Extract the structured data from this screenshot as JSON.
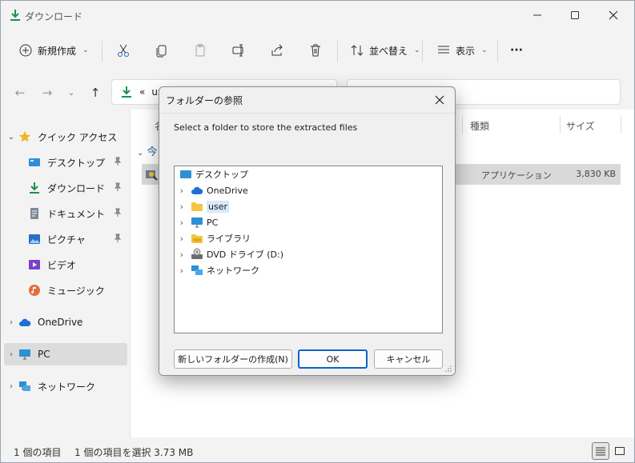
{
  "window": {
    "title": "ダウンロード"
  },
  "toolbar": {
    "new_label": "新規作成",
    "sort_label": "並べ替え",
    "view_label": "表示",
    "more_label": "···"
  },
  "address": {
    "prefix": "«",
    "path": "us"
  },
  "sidebar": {
    "quick_access": "クイック アクセス",
    "items": [
      "デスクトップ",
      "ダウンロード",
      "ドキュメント",
      "ピクチャ",
      "ビデオ",
      "ミュージック"
    ],
    "onedrive": "OneDrive",
    "pc": "PC",
    "network": "ネットワーク"
  },
  "content": {
    "col_name": "名",
    "col_type": "種類",
    "col_size": "サイズ",
    "group": "今",
    "file": {
      "type": "アプリケーション",
      "size": "3,830 KB"
    }
  },
  "status": {
    "count": "1 個の項目",
    "selection": "1 個の項目を選択  3.73 MB"
  },
  "dialog": {
    "title": "フォルダーの参照",
    "prompt": "Select a folder to store the extracted files",
    "tree": {
      "root": "デスクトップ",
      "children": [
        "OneDrive",
        "user",
        "PC",
        "ライブラリ",
        "DVD ドライブ (D:)",
        "ネットワーク"
      ]
    },
    "buttons": {
      "new_folder": "新しいフォルダーの作成(N)",
      "ok": "OK",
      "cancel": "キャンセル"
    }
  },
  "colors": {
    "accent": "#0a64c8",
    "download_green": "#1f8f4e",
    "folder_yellow": "#f5c542",
    "onedrive_blue": "#1f6fd1"
  }
}
